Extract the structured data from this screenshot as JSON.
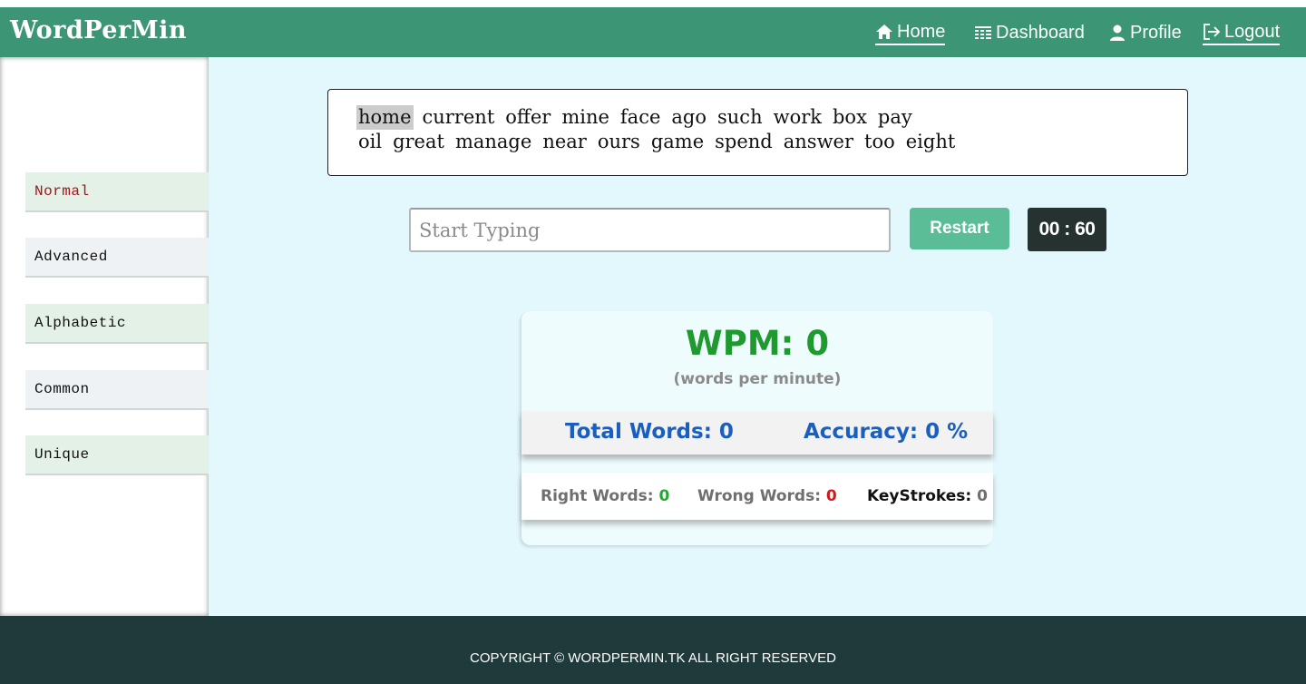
{
  "header": {
    "brand": "WordPerMin",
    "nav": {
      "home": "Home",
      "dashboard": "Dashboard",
      "profile": "Profile",
      "logout": "Logout"
    },
    "bg_color": "#3c9574"
  },
  "sidebar": {
    "items": [
      {
        "label": "Normal",
        "active": true
      },
      {
        "label": "Advanced",
        "active": false
      },
      {
        "label": "Alphabetic",
        "active": false
      },
      {
        "label": "Common",
        "active": false
      },
      {
        "label": "Unique",
        "active": false
      }
    ]
  },
  "typing": {
    "lines": [
      [
        "home",
        "current",
        "offer",
        "mine",
        "face",
        "ago",
        "such",
        "work",
        "box",
        "pay"
      ],
      [
        "oil",
        "great",
        "manage",
        "near",
        "ours",
        "game",
        "spend",
        "answer",
        "too",
        "eight"
      ]
    ],
    "current_word": "home",
    "input_value": "",
    "input_placeholder": "Start Typing",
    "restart_label": "Restart",
    "timer": "00 : 60"
  },
  "stats": {
    "wpm_text": "WPM: 0",
    "wpm_sub": "(words per minute)",
    "total_words_label": "Total Words: ",
    "total_words_value": "0",
    "accuracy_label": "Accuracy: ",
    "accuracy_value": "0 %",
    "right_words_label": "Right Words: ",
    "right_words_value": "0",
    "wrong_words_label": "Wrong Words: ",
    "wrong_words_value": "0",
    "keystrokes_label": "KeyStrokes: ",
    "keystrokes_value": "0"
  },
  "footer": {
    "copyright": "COPYRIGHT © WORDPERMIN.TK ALL RIGHT RESERVED"
  },
  "colors": {
    "accent": "#5bbd98",
    "wpm": "#1e9a2e",
    "stat_blue": "#1a5fc0",
    "footer_bg": "#1e3a3a",
    "main_bg": "#e3f8fd"
  }
}
